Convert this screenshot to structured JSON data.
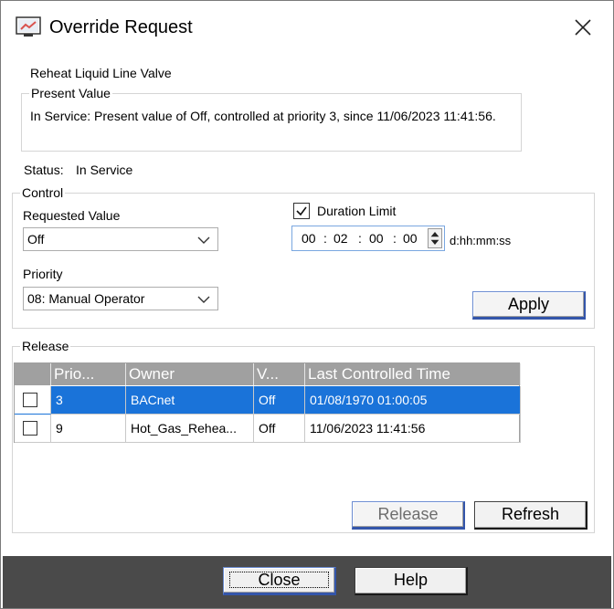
{
  "window": {
    "title": "Override Request"
  },
  "object_name": "Reheat Liquid Line Valve",
  "present_value": {
    "legend": "Present Value",
    "text": "In Service: Present value of Off, controlled at priority 3, since 11/06/2023 11:41:56."
  },
  "status": {
    "label": "Status:",
    "value": "In Service"
  },
  "control": {
    "legend": "Control",
    "requested_value_label": "Requested Value",
    "requested_value": "Off",
    "priority_label": "Priority",
    "priority": "08: Manual Operator",
    "duration_limit_label": "Duration Limit",
    "duration_limit_checked": true,
    "duration": {
      "d": "00",
      "hh": "02",
      "mm": "00",
      "ss": "00"
    },
    "duration_format": "d:hh:mm:ss",
    "apply_label": "Apply"
  },
  "release": {
    "legend": "Release",
    "columns": [
      "Prio...",
      "Owner",
      "V...",
      "Last Controlled Time"
    ],
    "rows": [
      {
        "checked": false,
        "priority": "3",
        "owner": "BACnet",
        "value": "Off",
        "time": "01/08/1970 01:00:05",
        "selected": true
      },
      {
        "checked": false,
        "priority": "9",
        "owner": "Hot_Gas_Rehea...",
        "value": "Off",
        "time": "11/06/2023 11:41:56",
        "selected": false
      }
    ],
    "release_label": "Release",
    "refresh_label": "Refresh"
  },
  "footer": {
    "close_label": "Close",
    "help_label": "Help"
  },
  "icons": {
    "app": "override-app-icon",
    "close": "close-x-icon",
    "dropdown": "chevron-down-icon",
    "spinner": "spin-up-down-icon",
    "checkbox": "checkbox-icon"
  },
  "colors": {
    "selection": "#1a73d9",
    "header": "#a0a0a0",
    "footer": "#4a4a4a"
  }
}
